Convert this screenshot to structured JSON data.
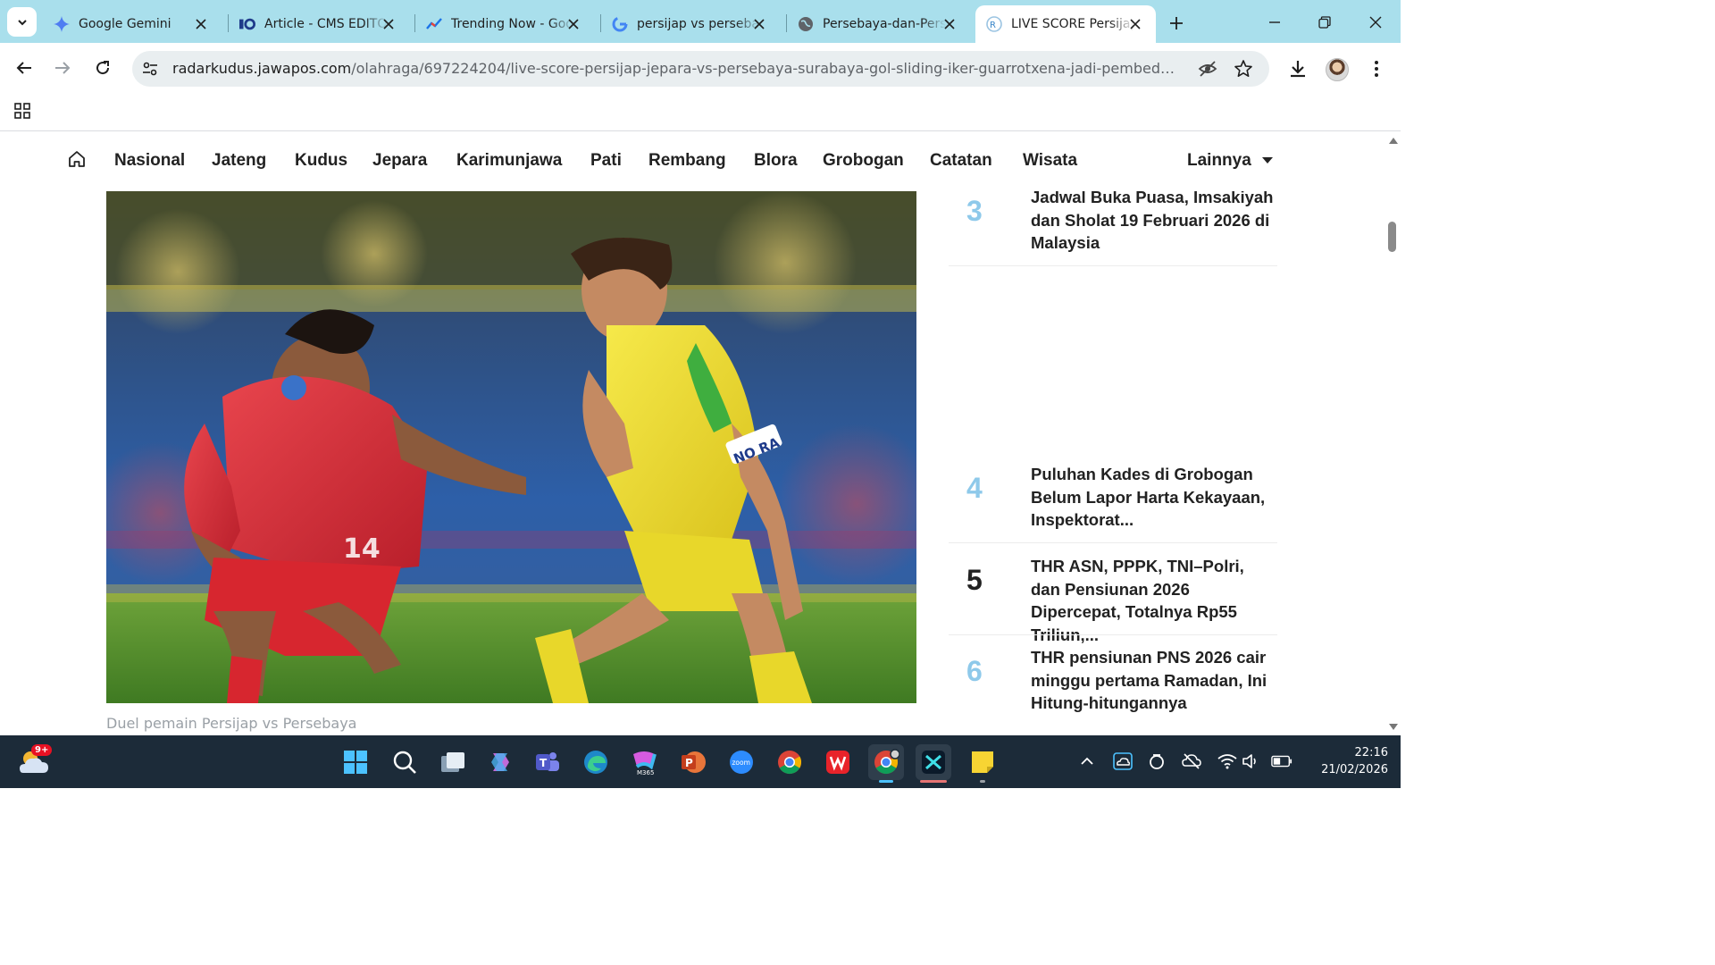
{
  "browser": {
    "tabs": [
      {
        "title": "Google Gemini",
        "icon": "gemini-icon"
      },
      {
        "title": "Article - CMS EDITOR",
        "icon": "cms-icon"
      },
      {
        "title": "Trending Now - Google Trends",
        "icon": "trends-icon"
      },
      {
        "title": "persijap vs persebaya - Google",
        "icon": "google-icon"
      },
      {
        "title": "Persebaya-dan-Persijap",
        "icon": "globe-icon"
      },
      {
        "title": "LIVE SCORE Persijap",
        "icon": "radarkudus-icon",
        "active": true
      }
    ],
    "url_host": "radarkudus.jawapos.com",
    "url_path": "/olahraga/697224204/live-score-persijap-jepara-vs-persebaya-surabaya-gol-sliding-iker-guarrotxena-jadi-pembeda#googl..."
  },
  "site": {
    "nav": [
      "Nasional",
      "Jateng",
      "Kudus",
      "Jepara",
      "Karimunjawa",
      "Pati",
      "Rembang",
      "Blora",
      "Grobogan",
      "Catatan",
      "Wisata"
    ],
    "more_label": "Lainnya",
    "caption": "Duel pemain Persijap vs Persebaya",
    "jersey_left_number": "14",
    "jersey_right_text": "NO RA",
    "popular": [
      {
        "rank": "3",
        "title": "Jadwal Buka Puasa, Imsakiyah dan Sholat 19 Februari 2026 di Malaysia"
      },
      {
        "rank": "4",
        "title": "Puluhan Kades di Grobogan Belum Lapor Harta Kekayaan, Inspektorat..."
      },
      {
        "rank": "5",
        "title": "THR ASN, PPPK, TNI–Polri, dan Pensiunan 2026 Dipercepat, Totalnya Rp55 Triliun,..."
      },
      {
        "rank": "6",
        "title": "THR pensiunan PNS 2026 cair minggu pertama Ramadan, Ini Hitung-hitungannya"
      }
    ]
  },
  "taskbar": {
    "weather_badge": "9+",
    "time": "22:16",
    "date": "21/02/2026"
  },
  "colors": {
    "tabstrip": "#a9dfec",
    "rank_light": "#8ec9ea",
    "taskbar": "#1c2b39"
  }
}
